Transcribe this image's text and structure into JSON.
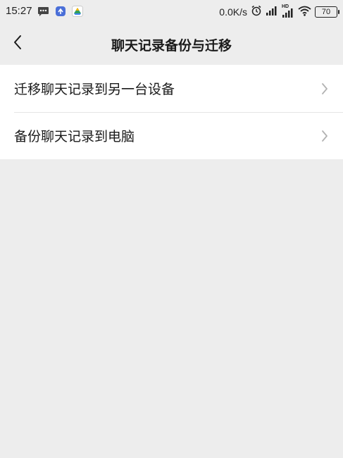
{
  "status_bar": {
    "time": "15:27",
    "network_speed": "0.0K/s",
    "hd_label": "HD",
    "battery_level": "70",
    "icons": [
      "message-icon",
      "app-notification-icon",
      "drive-icon",
      "alarm-icon",
      "signal-icon",
      "hd-signal-icon",
      "wifi-icon",
      "battery-icon"
    ]
  },
  "nav": {
    "title": "聊天记录备份与迁移",
    "back_icon": "chevron-left-icon"
  },
  "list": {
    "items": [
      {
        "label": "迁移聊天记录到另一台设备",
        "icon": "chevron-right-icon"
      },
      {
        "label": "备份聊天记录到电脑",
        "icon": "chevron-right-icon"
      }
    ]
  },
  "colors": {
    "background": "#ededed",
    "list_background": "#ffffff",
    "text": "#1a1a1a",
    "chevron": "#b2b2b2",
    "divider": "#e5e5e5"
  }
}
